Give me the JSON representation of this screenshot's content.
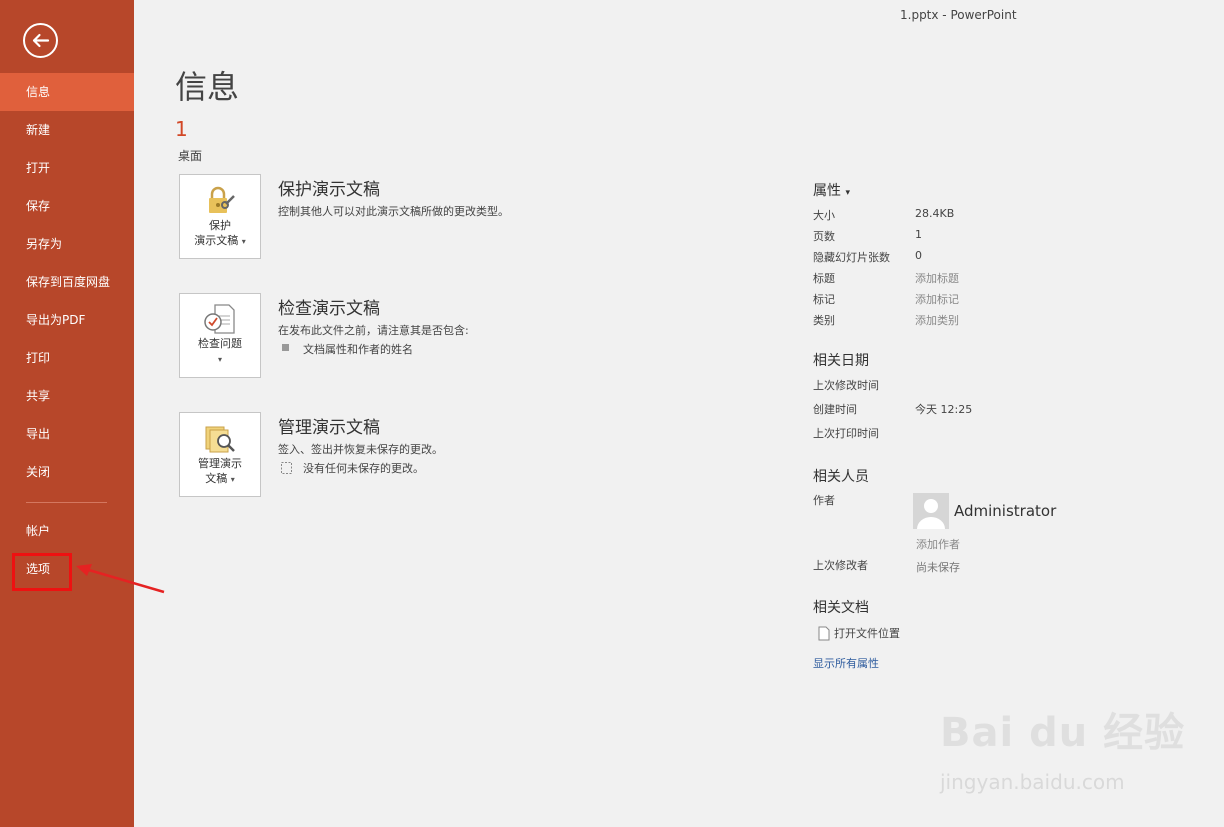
{
  "window_title": "1.pptx - PowerPoint",
  "sidebar": {
    "back_icon": "back-arrow-icon",
    "items": [
      {
        "label": "信息",
        "active": true
      },
      {
        "label": "新建"
      },
      {
        "label": "打开"
      },
      {
        "label": "保存"
      },
      {
        "label": "另存为"
      },
      {
        "label": "保存到百度网盘"
      },
      {
        "label": "导出为PDF"
      },
      {
        "label": "打印"
      },
      {
        "label": "共享"
      },
      {
        "label": "导出"
      },
      {
        "label": "关闭"
      }
    ],
    "bottom_items": [
      {
        "label": "帐户"
      },
      {
        "label": "选项"
      }
    ],
    "accent": "#b7472a",
    "active_color": "#e0603c"
  },
  "main": {
    "title": "信息",
    "doc_name": "1",
    "doc_location": "桌面",
    "sections": [
      {
        "tile_label_1": "保护",
        "tile_label_2": "演示文稿",
        "icon": "lock-key-icon",
        "title": "保护演示文稿",
        "desc": "控制其他人可以对此演示文稿所做的更改类型。"
      },
      {
        "tile_label_1": "检查问题",
        "icon": "inspect-document-icon",
        "title": "检查演示文稿",
        "desc": "在发布此文件之前，请注意其是否包含:",
        "note": "文档属性和作者的姓名"
      },
      {
        "tile_label_1": "管理演示",
        "tile_label_2": "文稿",
        "icon": "manage-versions-icon",
        "title": "管理演示文稿",
        "desc": "签入、签出并恢复未保存的更改。",
        "note": "没有任何未保存的更改。"
      }
    ]
  },
  "properties": {
    "heading": "属性",
    "rows": [
      {
        "key": "大小",
        "value": "28.4KB"
      },
      {
        "key": "页数",
        "value": "1"
      },
      {
        "key": "隐藏幻灯片张数",
        "value": "0"
      },
      {
        "key": "标题",
        "value": "添加标题"
      },
      {
        "key": "标记",
        "value": "添加标记"
      },
      {
        "key": "类别",
        "value": "添加类别"
      }
    ],
    "dates_heading": "相关日期",
    "dates": [
      {
        "key": "上次修改时间",
        "value": ""
      },
      {
        "key": "创建时间",
        "value": "今天 12:25"
      },
      {
        "key": "上次打印时间",
        "value": ""
      }
    ],
    "people_heading": "相关人员",
    "author_key": "作者",
    "author_name": "Administrator",
    "add_author": "添加作者",
    "last_modified_by_key": "上次修改者",
    "last_modified_by_value": "尚未保存",
    "docs_heading": "相关文档",
    "open_location": "打开文件位置",
    "show_all": "显示所有属性"
  },
  "watermark": {
    "text": "Bai du 经验",
    "sub": "jingyan.baidu.com"
  }
}
